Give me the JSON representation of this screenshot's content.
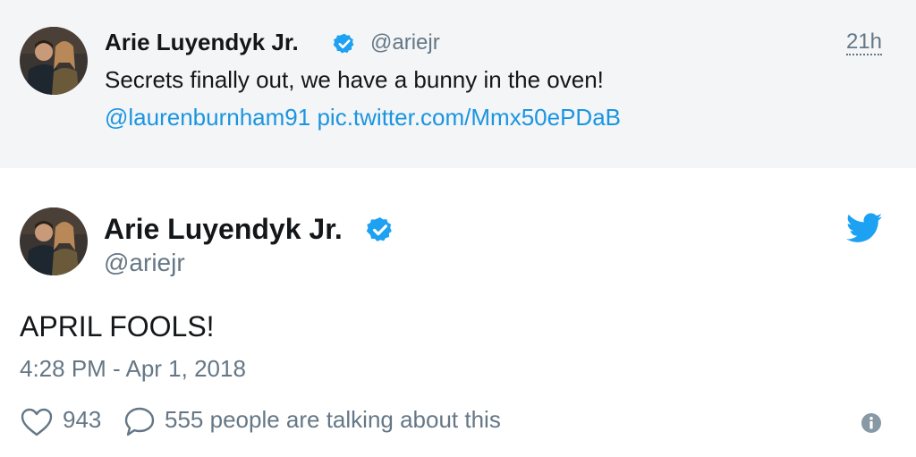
{
  "quoted_tweet": {
    "author_name": "Arie Luyendyk Jr.",
    "handle": "@ariejr",
    "time": "21h",
    "text": "Secrets finally out, we have a bunny in the oven!",
    "mention": "@laurenburnham91",
    "media_link": "pic.twitter.com/Mmx50ePDaB"
  },
  "tweet": {
    "author_name": "Arie Luyendyk Jr.",
    "handle": "@ariejr",
    "text": "APRIL FOOLS!",
    "timestamp": "4:28 PM - Apr 1, 2018",
    "likes": "943",
    "talking": "555 people are talking about this"
  },
  "icons": {
    "verified": "verified-badge-icon",
    "brand": "twitter-bird-icon",
    "like": "heart-icon",
    "reply": "speech-bubble-icon",
    "info": "info-icon"
  },
  "colors": {
    "link": "#1b95e0",
    "verified": "#1da1f2",
    "muted": "#657786",
    "quoted_background": "#f3f5f7"
  }
}
